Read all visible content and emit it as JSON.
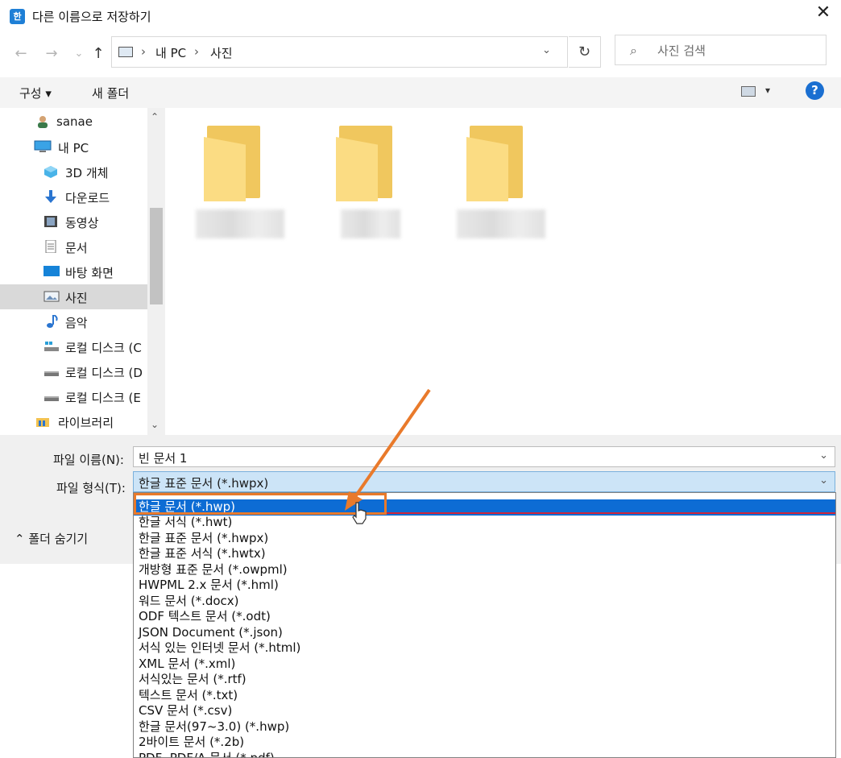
{
  "window": {
    "title": "다른 이름으로 저장하기",
    "app_icon_glyph": "한",
    "close": "✕"
  },
  "nav": {
    "back": "←",
    "forward": "→",
    "recent": "⌄",
    "up": "↑"
  },
  "address": {
    "crumbs": [
      "내 PC",
      "사진"
    ],
    "separator": "›",
    "dropdown": "⌄",
    "refresh": "↻"
  },
  "search": {
    "placeholder": "사진 검색",
    "icon": "⌕"
  },
  "toolbar": {
    "organize": "구성 ▾",
    "new_folder": "새 폴더",
    "view_dropdown": "▾",
    "help": "?"
  },
  "sidebar": {
    "items": [
      {
        "label": "sanae",
        "icon": "user-icon"
      },
      {
        "label": "내 PC",
        "icon": "computer-icon"
      },
      {
        "label": "3D 개체",
        "icon": "3d-objects-icon"
      },
      {
        "label": "다운로드",
        "icon": "download-icon"
      },
      {
        "label": "동영상",
        "icon": "video-icon"
      },
      {
        "label": "문서",
        "icon": "document-icon"
      },
      {
        "label": "바탕 화면",
        "icon": "desktop-icon"
      },
      {
        "label": "사진",
        "icon": "pictures-icon",
        "selected": true
      },
      {
        "label": "음악",
        "icon": "music-icon"
      },
      {
        "label": "로컬 디스크 (C",
        "icon": "drive-icon"
      },
      {
        "label": "로컬 디스크 (D",
        "icon": "drive-icon"
      },
      {
        "label": "로컬 디스크 (E",
        "icon": "drive-icon"
      },
      {
        "label": "라이브러리",
        "icon": "library-icon"
      }
    ]
  },
  "form": {
    "filename_label": "파일 이름(N):",
    "filename_value": "빈 문서 1",
    "filetype_label": "파일 형식(T):",
    "filetype_value": "한글 표준 문서 (*.hwpx)",
    "hide_folders": "폴더 숨기기"
  },
  "filetype_options": [
    "한글 문서 (*.hwp)",
    "한글 서식 (*.hwt)",
    "한글 표준 문서 (*.hwpx)",
    "한글 표준 서식 (*.hwtx)",
    "개방형 표준 문서 (*.owpml)",
    "HWPML 2.x 문서 (*.hml)",
    "워드 문서 (*.docx)",
    "ODF 텍스트 문서 (*.odt)",
    "JSON Document (*.json)",
    "서식 있는 인터넷 문서 (*.html)",
    "XML 문서 (*.xml)",
    "서식있는 문서 (*.rtf)",
    "텍스트 문서 (*.txt)",
    "CSV 문서 (*.csv)",
    "한글 문서(97~3.0) (*.hwp)",
    "2바이트 문서 (*.2b)",
    "PDF, PDF/A 문서 (*.pdf)"
  ],
  "highlighted_option": "한글 문서 (*.hwp)",
  "colors": {
    "highlight": "#0d6cd4",
    "annotation": "#e97a2b",
    "folder": "#f0c75e"
  }
}
